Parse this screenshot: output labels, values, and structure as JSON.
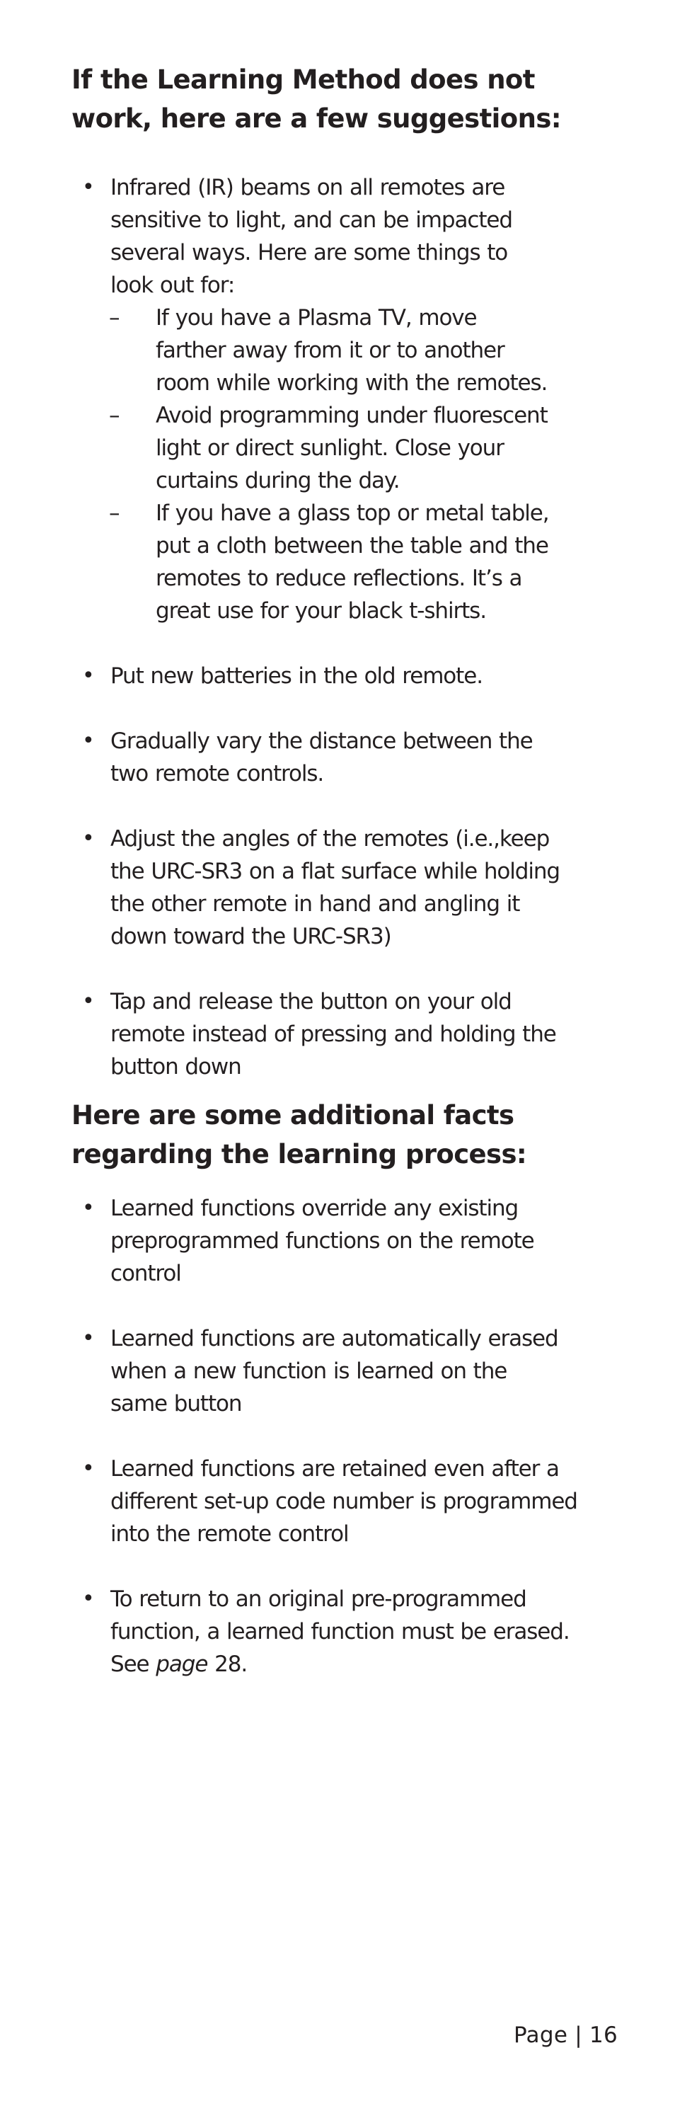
{
  "section1": {
    "heading_lines": [
      "If the Learning Method does not",
      "work, here are a few suggestions:"
    ],
    "items": [
      {
        "bullet": "•",
        "lines": [
          "Infrared (IR) beams on all remotes are",
          "sensitive to light, and can be impacted",
          "several ways. Here are some things to",
          "look out for:"
        ],
        "subitems": [
          {
            "dash": "–",
            "lines": [
              "If you have a Plasma TV, move",
              "farther away from it or to another",
              "room while working with the remotes."
            ]
          },
          {
            "dash": "–",
            "lines": [
              "Avoid programming under fluorescent",
              "light or direct sunlight. Close your",
              "curtains during the day."
            ]
          },
          {
            "dash": "–",
            "lines": [
              "If you have a glass top or metal table,",
              "put a cloth between the table and the",
              "remotes to reduce reflections. It’s a",
              "great use for your black t-shirts."
            ]
          }
        ]
      },
      {
        "bullet": "•",
        "lines": [
          "Put new batteries in the old remote."
        ]
      },
      {
        "bullet": "•",
        "lines": [
          "Gradually vary the distance between the",
          "two remote controls."
        ]
      },
      {
        "bullet": "•",
        "lines": [
          "Adjust the angles of the remotes (i.e.,keep",
          "the URC-SR3 on a flat surface while holding",
          "the other remote in hand and angling it",
          "down toward the URC-SR3)"
        ]
      },
      {
        "bullet": "•",
        "lines": [
          "Tap and release the button on your old",
          "remote instead of pressing and holding the",
          "button down"
        ]
      }
    ]
  },
  "section2": {
    "heading_lines": [
      "Here are some additional facts",
      "regarding the learning process:"
    ],
    "items": [
      {
        "bullet": "•",
        "lines": [
          "Learned functions override any existing",
          "preprogrammed functions on the remote",
          "control"
        ]
      },
      {
        "bullet": "•",
        "lines": [
          "Learned functions are automatically erased",
          "when a new function is learned on the",
          "same button"
        ]
      },
      {
        "bullet": "•",
        "lines": [
          "Learned functions are retained even after a",
          "different set-up code number is programmed",
          "into the remote control"
        ]
      },
      {
        "bullet": "•",
        "lines": [
          "To return to an original pre-programmed",
          "function, a learned function must be erased."
        ],
        "reference": {
          "prefix": "See ",
          "italic": "page",
          "suffix": " 28."
        }
      }
    ]
  },
  "footer": {
    "label": "Page",
    "separator": "|",
    "page_number": "16"
  }
}
